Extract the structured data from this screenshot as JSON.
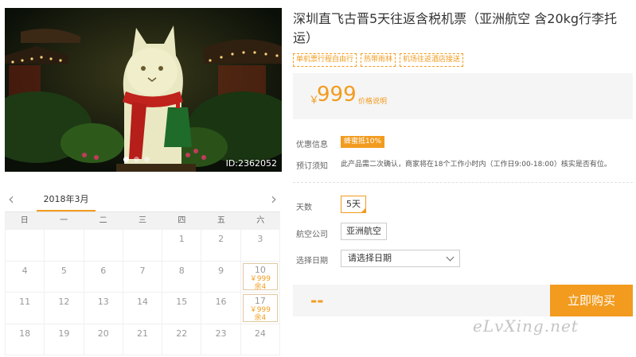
{
  "photo": {
    "id_label": "ID:2362052",
    "slide_count": 3,
    "active_slide": 0
  },
  "calendar": {
    "month_label": "2018年3月",
    "prev_icon": "chevron-left-icon",
    "next_icon": "chevron-right-icon",
    "weekdays": [
      "日",
      "一",
      "二",
      "三",
      "四",
      "五",
      "六"
    ],
    "rows": [
      [
        null,
        null,
        null,
        null,
        "1",
        "2",
        "3"
      ],
      [
        "4",
        "5",
        "6",
        "7",
        "8",
        "9",
        {
          "day": "10",
          "price": "￥999",
          "stock": "余4"
        }
      ],
      [
        "11",
        "12",
        "13",
        "14",
        "15",
        "16",
        {
          "day": "17",
          "price": "￥999",
          "stock": "余4"
        }
      ],
      [
        "18",
        "19",
        "20",
        "21",
        "22",
        "23",
        "24"
      ]
    ]
  },
  "product": {
    "title": "深圳直飞古晋5天往返含税机票（亚洲航空 含20kg行李托运）",
    "tags": [
      "单机票行程自由行",
      "热带雨林",
      "机场往返酒店接送"
    ],
    "price_symbol": "￥",
    "price": "999",
    "price_note": "价格说明",
    "discount_label": "优惠信息",
    "discount_badge": "蜂蜜抵10%",
    "notice_label": "预订须知",
    "notice_text": "此产品需二次确认，商家将在18个工作小时内（工作日9:00-18:00）核实是否有位。",
    "days_label": "天数",
    "days_value": "5天",
    "airline_label": "航空公司",
    "airline_value": "亚洲航空",
    "date_label": "选择日期",
    "date_placeholder": "请选择日期",
    "total": "--",
    "buy_label": "立即购买"
  },
  "watermark": "eLvXing.net",
  "colors": {
    "accent": "#f29b1e",
    "panel": "#f5f5f5"
  }
}
